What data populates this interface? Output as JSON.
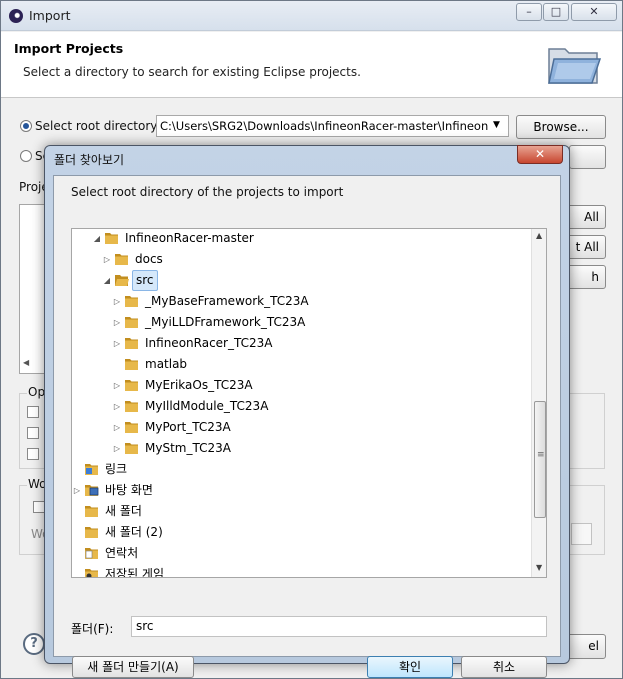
{
  "window": {
    "title": "Import"
  },
  "header": {
    "title": "Import Projects",
    "subtitle": "Select a directory to search for existing Eclipse projects."
  },
  "source": {
    "root_radio_label": "Select root directory:",
    "root_path": "C:\\Users\\SRG2\\Downloads\\InfineonRacer-master\\Infineon",
    "browse_label": "Browse...",
    "archive_radio_label": "Se",
    "projects_label": "Proje"
  },
  "right_buttons": {
    "select_all": "All",
    "deselect_all": "t All",
    "refresh": "h"
  },
  "options": {
    "label": "Opti",
    "working_sets_label": "Wo",
    "working_label_2": "Wo"
  },
  "footer": {
    "help_glyph": "?",
    "cancel_partial": "el"
  },
  "dialog": {
    "title": "폴더 찾아보기",
    "close_glyph": "✕",
    "instruction": "Select root directory of the projects to import",
    "tree": [
      {
        "label": "InfineonRacer-master",
        "arrow": "◢",
        "indent": 0,
        "icon": "folder"
      },
      {
        "label": "docs",
        "arrow": "▷",
        "indent": 1,
        "icon": "folder"
      },
      {
        "label": "src",
        "arrow": "◢",
        "indent": 1,
        "icon": "folder-open",
        "selected": true
      },
      {
        "label": "_MyBaseFramework_TC23A",
        "arrow": "▷",
        "indent": 2,
        "icon": "folder"
      },
      {
        "label": "_MyiLLDFramework_TC23A",
        "arrow": "▷",
        "indent": 2,
        "icon": "folder"
      },
      {
        "label": "InfineonRacer_TC23A",
        "arrow": "▷",
        "indent": 2,
        "icon": "folder"
      },
      {
        "label": "matlab",
        "arrow": "",
        "indent": 2,
        "icon": "folder"
      },
      {
        "label": "MyErikaOs_TC23A",
        "arrow": "▷",
        "indent": 2,
        "icon": "folder"
      },
      {
        "label": "MyIlldModule_TC23A",
        "arrow": "▷",
        "indent": 2,
        "icon": "folder"
      },
      {
        "label": "MyPort_TC23A",
        "arrow": "▷",
        "indent": 2,
        "icon": "folder"
      },
      {
        "label": "MyStm_TC23A",
        "arrow": "▷",
        "indent": 2,
        "icon": "folder"
      },
      {
        "label": "링크",
        "arrow": "",
        "indent": -1,
        "icon": "links-folder"
      },
      {
        "label": "바탕 화면",
        "arrow": "▷",
        "indent": -1,
        "icon": "desktop-folder"
      },
      {
        "label": "새 폴더",
        "arrow": "",
        "indent": -1,
        "icon": "folder"
      },
      {
        "label": "새 폴더 (2)",
        "arrow": "",
        "indent": -1,
        "icon": "folder"
      },
      {
        "label": "연락처",
        "arrow": "",
        "indent": -1,
        "icon": "contacts-folder"
      },
      {
        "label": "저장된 게임",
        "arrow": "",
        "indent": -1,
        "icon": "games-folder"
      }
    ],
    "folder_field_label": "폴더(F):",
    "folder_value": "src",
    "new_folder_button": "새 폴더 만들기(A)",
    "ok_button": "확인",
    "cancel_button": "취소"
  },
  "colors": {
    "folder": "#e7b84a",
    "folder_dark": "#c28e1f",
    "selection": "#d5e8fa",
    "title_gradient": "#c3d3e6"
  }
}
